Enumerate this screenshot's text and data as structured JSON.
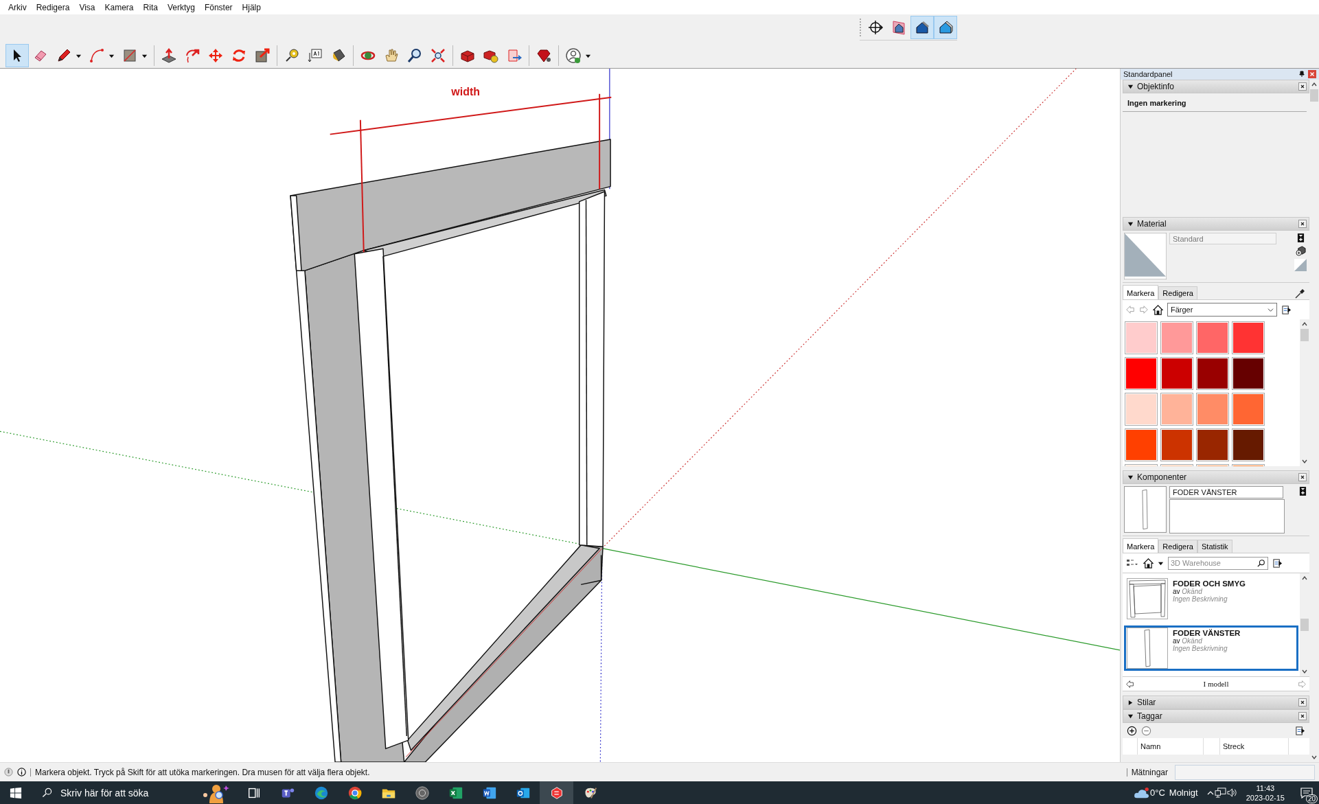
{
  "menu": [
    "Arkiv",
    "Redigera",
    "Visa",
    "Kamera",
    "Rita",
    "Verktyg",
    "Fönster",
    "Hjälp"
  ],
  "view_toolbar": [
    {
      "kind": "compass",
      "selected": false
    },
    {
      "kind": "house-framed",
      "selected": false
    },
    {
      "kind": "house-dark",
      "selected": true
    },
    {
      "kind": "house-light",
      "selected": true
    }
  ],
  "toolbar": [
    [
      {
        "kind": "select",
        "selected": true,
        "dropdown": false
      },
      {
        "kind": "eraser",
        "selected": false,
        "dropdown": false
      },
      {
        "kind": "pencil",
        "selected": false,
        "dropdown": true
      },
      {
        "kind": "arc",
        "selected": false,
        "dropdown": true
      },
      {
        "kind": "rectangle",
        "selected": false,
        "dropdown": true
      }
    ],
    [
      {
        "kind": "pushpull",
        "selected": false,
        "dropdown": false
      },
      {
        "kind": "offset",
        "selected": false,
        "dropdown": false
      },
      {
        "kind": "move",
        "selected": false,
        "dropdown": false
      },
      {
        "kind": "rotate",
        "selected": false,
        "dropdown": false
      },
      {
        "kind": "scale",
        "selected": false,
        "dropdown": false
      }
    ],
    [
      {
        "kind": "tape",
        "selected": false,
        "dropdown": false
      },
      {
        "kind": "text",
        "selected": false,
        "dropdown": false
      },
      {
        "kind": "paint",
        "selected": false,
        "dropdown": false
      }
    ],
    [
      {
        "kind": "orbit",
        "selected": false,
        "dropdown": false
      },
      {
        "kind": "pan",
        "selected": false,
        "dropdown": false
      },
      {
        "kind": "zoom",
        "selected": false,
        "dropdown": false
      },
      {
        "kind": "extents",
        "selected": false,
        "dropdown": false
      }
    ],
    [
      {
        "kind": "warehouse",
        "selected": false,
        "dropdown": false
      },
      {
        "kind": "extensions",
        "selected": false,
        "dropdown": false
      },
      {
        "kind": "share",
        "selected": false,
        "dropdown": false
      }
    ],
    [
      {
        "kind": "ruby",
        "selected": false,
        "dropdown": false
      }
    ],
    [
      {
        "kind": "account",
        "selected": false,
        "dropdown": true
      }
    ]
  ],
  "canvas": {
    "dimension_label": "width"
  },
  "panel": {
    "title": "Standardpanel",
    "entity_info": {
      "title": "Objektinfo",
      "expanded": true,
      "text": "Ingen markering"
    },
    "materials": {
      "title": "Material",
      "expanded": true,
      "name": "Standard",
      "tabs": [
        {
          "label": "Markera",
          "selected": true
        },
        {
          "label": "Redigera",
          "selected": false
        }
      ],
      "library": "Färger",
      "swatches": [
        {
          "color": "#ffcccc"
        },
        {
          "color": "#ff9999"
        },
        {
          "color": "#ff6666"
        },
        {
          "color": "#ff3333"
        },
        {
          "color": "#ff0000"
        },
        {
          "color": "#cc0000"
        },
        {
          "color": "#990000"
        },
        {
          "color": "#660000"
        },
        {
          "color": "#ffd9cc"
        },
        {
          "color": "#ffb399"
        },
        {
          "color": "#ff8c66"
        },
        {
          "color": "#ff6633"
        },
        {
          "color": "#ff4000"
        },
        {
          "color": "#cc3300"
        },
        {
          "color": "#992600"
        },
        {
          "color": "#661a00"
        },
        {
          "color": "#ffe0cc"
        },
        {
          "color": "#ffc299"
        },
        {
          "color": "#ffa366"
        },
        {
          "color": "#ff8533"
        }
      ]
    },
    "components": {
      "title": "Komponenter",
      "expanded": true,
      "name": "FODER VÄNSTER",
      "tabs": [
        {
          "label": "Markera",
          "selected": true
        },
        {
          "label": "Redigera",
          "selected": false
        },
        {
          "label": "Statistik",
          "selected": false
        }
      ],
      "search": {
        "placeholder": "3D Warehouse"
      },
      "items": [
        {
          "name": "FODER OCH SMYG",
          "by": "av",
          "author": "Okänd",
          "description": "Ingen Beskrivning",
          "kind": "frame",
          "selected": false
        },
        {
          "name": "FODER VÄNSTER",
          "by": "av",
          "author": "Okänd",
          "description": "Ingen Beskrivning",
          "kind": "post",
          "selected": true
        }
      ],
      "collection": "I modell"
    },
    "styles": {
      "title": "Stilar",
      "expanded": false
    },
    "tags": {
      "title": "Taggar",
      "expanded": true,
      "columns": [
        "Namn",
        "Streck"
      ]
    }
  },
  "status_bar": {
    "message": "Markera objekt. Tryck på Skift för att utöka markeringen. Dra musen för att välja flera objekt.",
    "measurements_label": "Mätningar"
  },
  "taskbar": {
    "search": {
      "placeholder": "Skriv här för att söka"
    },
    "apps": [
      {
        "kind": "taskview",
        "active": false
      },
      {
        "kind": "teams",
        "active": false
      },
      {
        "kind": "edge",
        "active": false
      },
      {
        "kind": "chrome",
        "active": false
      },
      {
        "kind": "explorer",
        "active": false
      },
      {
        "kind": "disc",
        "active": false
      },
      {
        "kind": "excel",
        "active": false
      },
      {
        "kind": "word",
        "active": false
      },
      {
        "kind": "outlook",
        "active": false
      },
      {
        "kind": "sketchup",
        "active": true
      },
      {
        "kind": "paint",
        "active": false
      }
    ],
    "weather": {
      "temperature": "0°C",
      "condition": "Molnigt"
    },
    "time": "11:43",
    "date": "2023-02-15",
    "notifications": "20"
  }
}
